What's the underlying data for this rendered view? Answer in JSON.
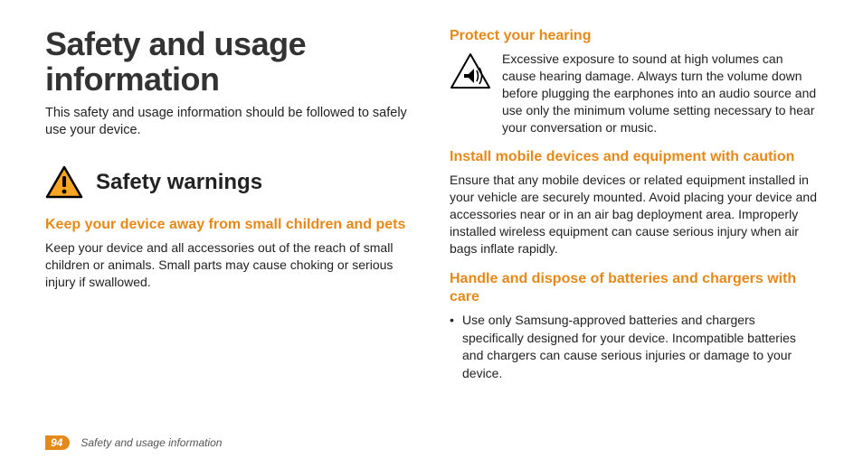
{
  "page": {
    "title": "Safety and usage information",
    "intro": "This safety and usage information should be followed to safely use your device.",
    "number": "94",
    "footer_text": "Safety and usage information"
  },
  "left": {
    "section_heading": "Safety warnings",
    "sub1_title": "Keep your device away from small children and pets",
    "sub1_body": "Keep your device and all accessories out of the reach of small children or animals. Small parts may cause choking or serious injury if swallowed."
  },
  "right": {
    "sub1_title": "Protect your hearing",
    "sub1_body": "Excessive exposure to sound at high volumes can cause hearing damage. Always turn the volume down before plugging the earphones into an audio source and use only the minimum volume setting necessary to hear your conversation or music.",
    "sub2_title": "Install mobile devices and equipment with caution",
    "sub2_body": "Ensure that any mobile devices or related equipment installed in your vehicle are securely mounted. Avoid placing your device and accessories near or in an air bag deployment area. Improperly installed wireless equipment can cause serious injury when air bags inflate rapidly.",
    "sub3_title": "Handle and dispose of batteries and chargers with care",
    "sub3_bullet1": "Use only Samsung-approved batteries and chargers specifically designed for your device. Incompatible batteries and chargers can cause serious injuries or damage to your device."
  }
}
